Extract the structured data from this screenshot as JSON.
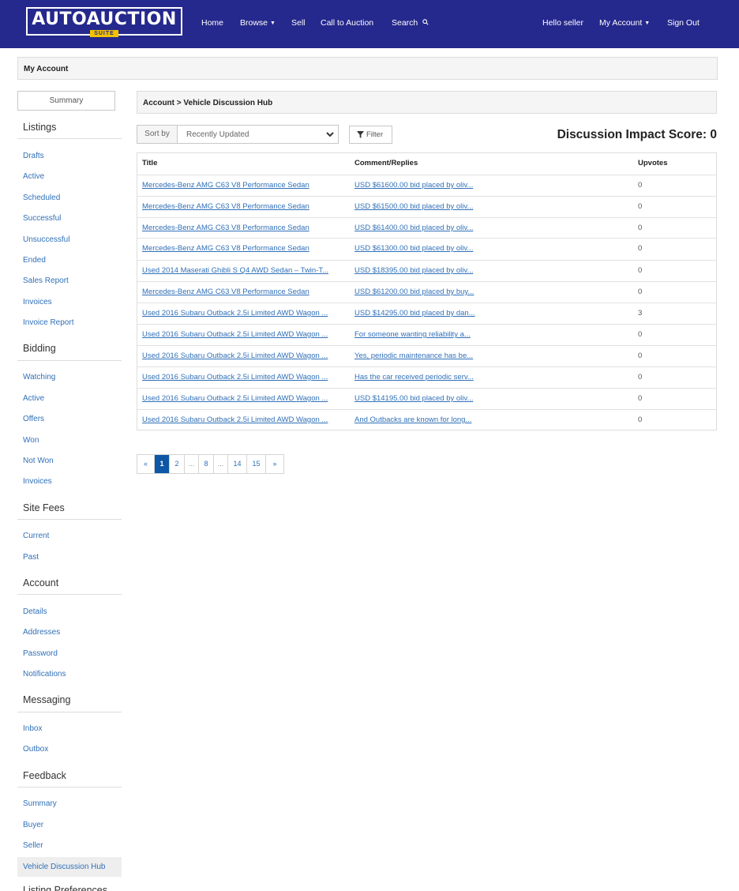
{
  "header": {
    "logo_text": "AUTOAUCTION",
    "logo_suite": "SUITE",
    "nav": {
      "home": "Home",
      "browse": "Browse",
      "sell": "Sell",
      "call_to_auction": "Call to Auction",
      "search": "Search",
      "hello": "Hello seller",
      "my_account": "My Account",
      "sign_out": "Sign Out"
    },
    "background_color": "#25288c"
  },
  "page_title": "My Account",
  "sidebar": {
    "summary_button": "Summary",
    "sections": [
      {
        "heading": "Listings",
        "items": [
          "Drafts",
          "Active",
          "Scheduled",
          "Successful",
          "Unsuccessful",
          "Ended",
          "Sales Report",
          "Invoices",
          "Invoice Report"
        ]
      },
      {
        "heading": "Bidding",
        "items": [
          "Watching",
          "Active",
          "Offers",
          "Won",
          "Not Won",
          "Invoices"
        ]
      },
      {
        "heading": "Site Fees",
        "items": [
          "Current",
          "Past"
        ]
      },
      {
        "heading": "Account",
        "items": [
          "Details",
          "Addresses",
          "Password",
          "Notifications"
        ]
      },
      {
        "heading": "Messaging",
        "items": [
          "Inbox",
          "Outbox"
        ]
      },
      {
        "heading": "Feedback",
        "items": [
          "Summary",
          "Buyer",
          "Seller",
          "Vehicle Discussion Hub"
        ]
      },
      {
        "heading": "Listing Preferences",
        "items": []
      }
    ],
    "active_item": "Vehicle Discussion Hub"
  },
  "main": {
    "breadcrumb": "Account > Vehicle Discussion Hub",
    "sort_label": "Sort by",
    "sort_value": "Recently Updated",
    "filter_label": "Filter",
    "impact_score": "Discussion Impact Score: 0",
    "table": {
      "columns": [
        "Title",
        "Comment/Replies",
        "Upvotes"
      ],
      "rows": [
        [
          "Mercedes-Benz AMG C63 V8 Performance Sedan",
          "USD $61600.00 bid placed by oliv...",
          "0"
        ],
        [
          "Mercedes-Benz AMG C63 V8 Performance Sedan",
          "USD $61500.00 bid placed by oliv...",
          "0"
        ],
        [
          "Mercedes-Benz AMG C63 V8 Performance Sedan",
          "USD $61400.00 bid placed by oliv...",
          "0"
        ],
        [
          "Mercedes-Benz AMG C63 V8 Performance Sedan",
          "USD $61300.00 bid placed by oliv...",
          "0"
        ],
        [
          "Used 2014 Maserati Ghibli S Q4 AWD Sedan – Twin-T...",
          "USD $18395.00 bid placed by oliv...",
          "0"
        ],
        [
          "Mercedes-Benz AMG C63 V8 Performance Sedan",
          "USD $61200.00 bid placed by buy...",
          "0"
        ],
        [
          "Used 2016 Subaru Outback 2.5i Limited AWD Wagon ...",
          "USD $14295.00 bid placed by dan...",
          "3"
        ],
        [
          "Used 2016 Subaru Outback 2.5i Limited AWD Wagon ...",
          "For someone wanting reliability a...",
          "0"
        ],
        [
          "Used 2016 Subaru Outback 2.5i Limited AWD Wagon ...",
          "Yes, periodic maintenance has be...",
          "0"
        ],
        [
          "Used 2016 Subaru Outback 2.5i Limited AWD Wagon ...",
          "Has the car received periodic serv...",
          "0"
        ],
        [
          "Used 2016 Subaru Outback 2.5i Limited AWD Wagon ...",
          "USD $14195.00 bid placed by oliv...",
          "0"
        ],
        [
          "Used 2016 Subaru Outback 2.5i Limited AWD Wagon ...",
          "And Outbacks are known for long...",
          "0"
        ]
      ]
    },
    "pagination": {
      "prev": "«",
      "pages": [
        "1",
        "2",
        "...",
        "8",
        "...",
        "14",
        "15"
      ],
      "current": "1",
      "next": "»"
    }
  }
}
